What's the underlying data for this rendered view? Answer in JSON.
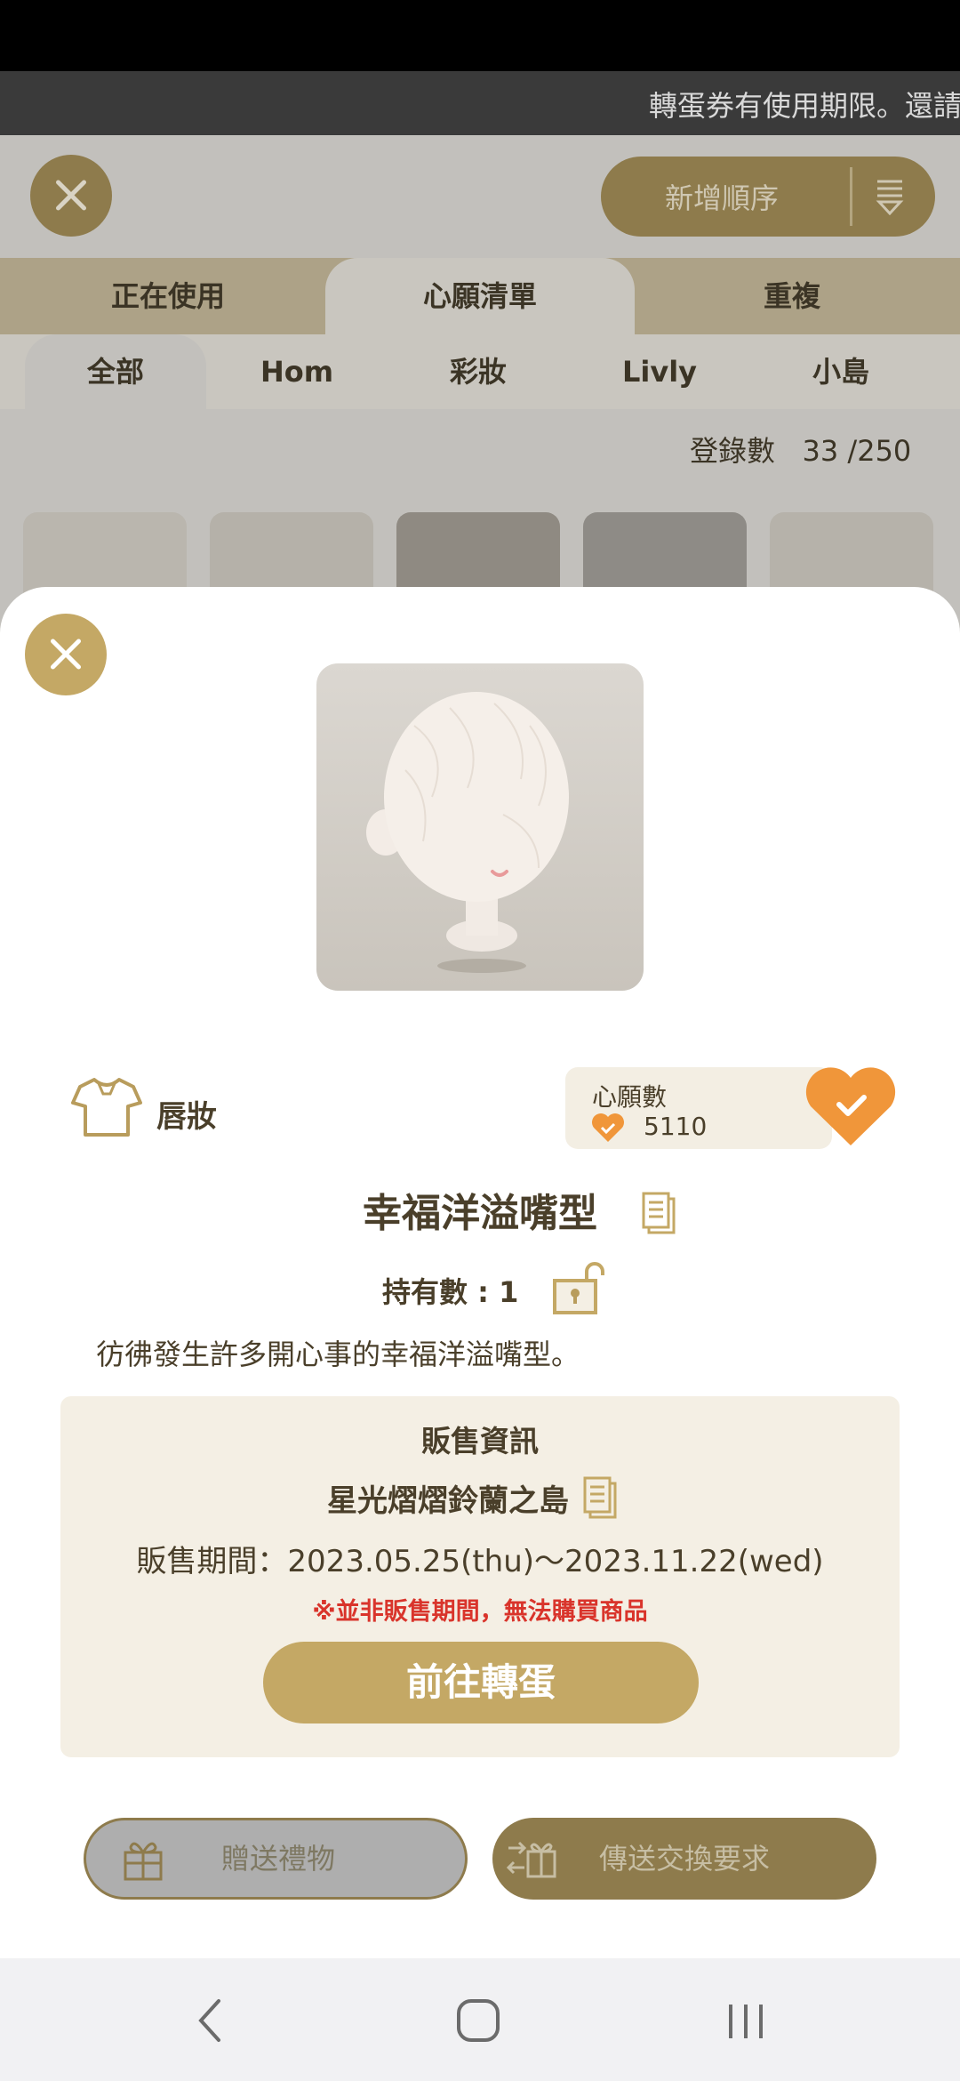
{
  "ticker": {
    "text": "轉蛋券有使用期限。還請"
  },
  "background": {
    "sort_label": "新增順序",
    "tabs": [
      "正在使用",
      "心願清單",
      "重複"
    ],
    "subtabs": [
      "全部",
      "Hom",
      "彩妝",
      "Livly",
      "小島"
    ],
    "count_label": "登錄數",
    "count_value": "33 /250"
  },
  "item": {
    "category": "唇妝",
    "wish_label": "心願數",
    "wish_count": "5110",
    "name": "幸福洋溢嘴型",
    "owned": "持有數 : 1",
    "description": "彷彿發生許多開心事的幸福洋溢嘴型。"
  },
  "sale": {
    "title": "販售資訊",
    "island": "星光熠熠鈴蘭之島",
    "period": "販售期間：2023.05.25(thu)～2023.11.22(wed)",
    "warning": "※並非販售期間，無法購買商品",
    "goto_button": "前往轉蛋"
  },
  "actions": {
    "gift": "贈送禮物",
    "trade": "傳送交換要求"
  },
  "colors": {
    "gold": "#c4a865",
    "dark_gold": "#8e7b4c",
    "heart_orange": "#f0963a",
    "warning_red": "#d9342b"
  }
}
